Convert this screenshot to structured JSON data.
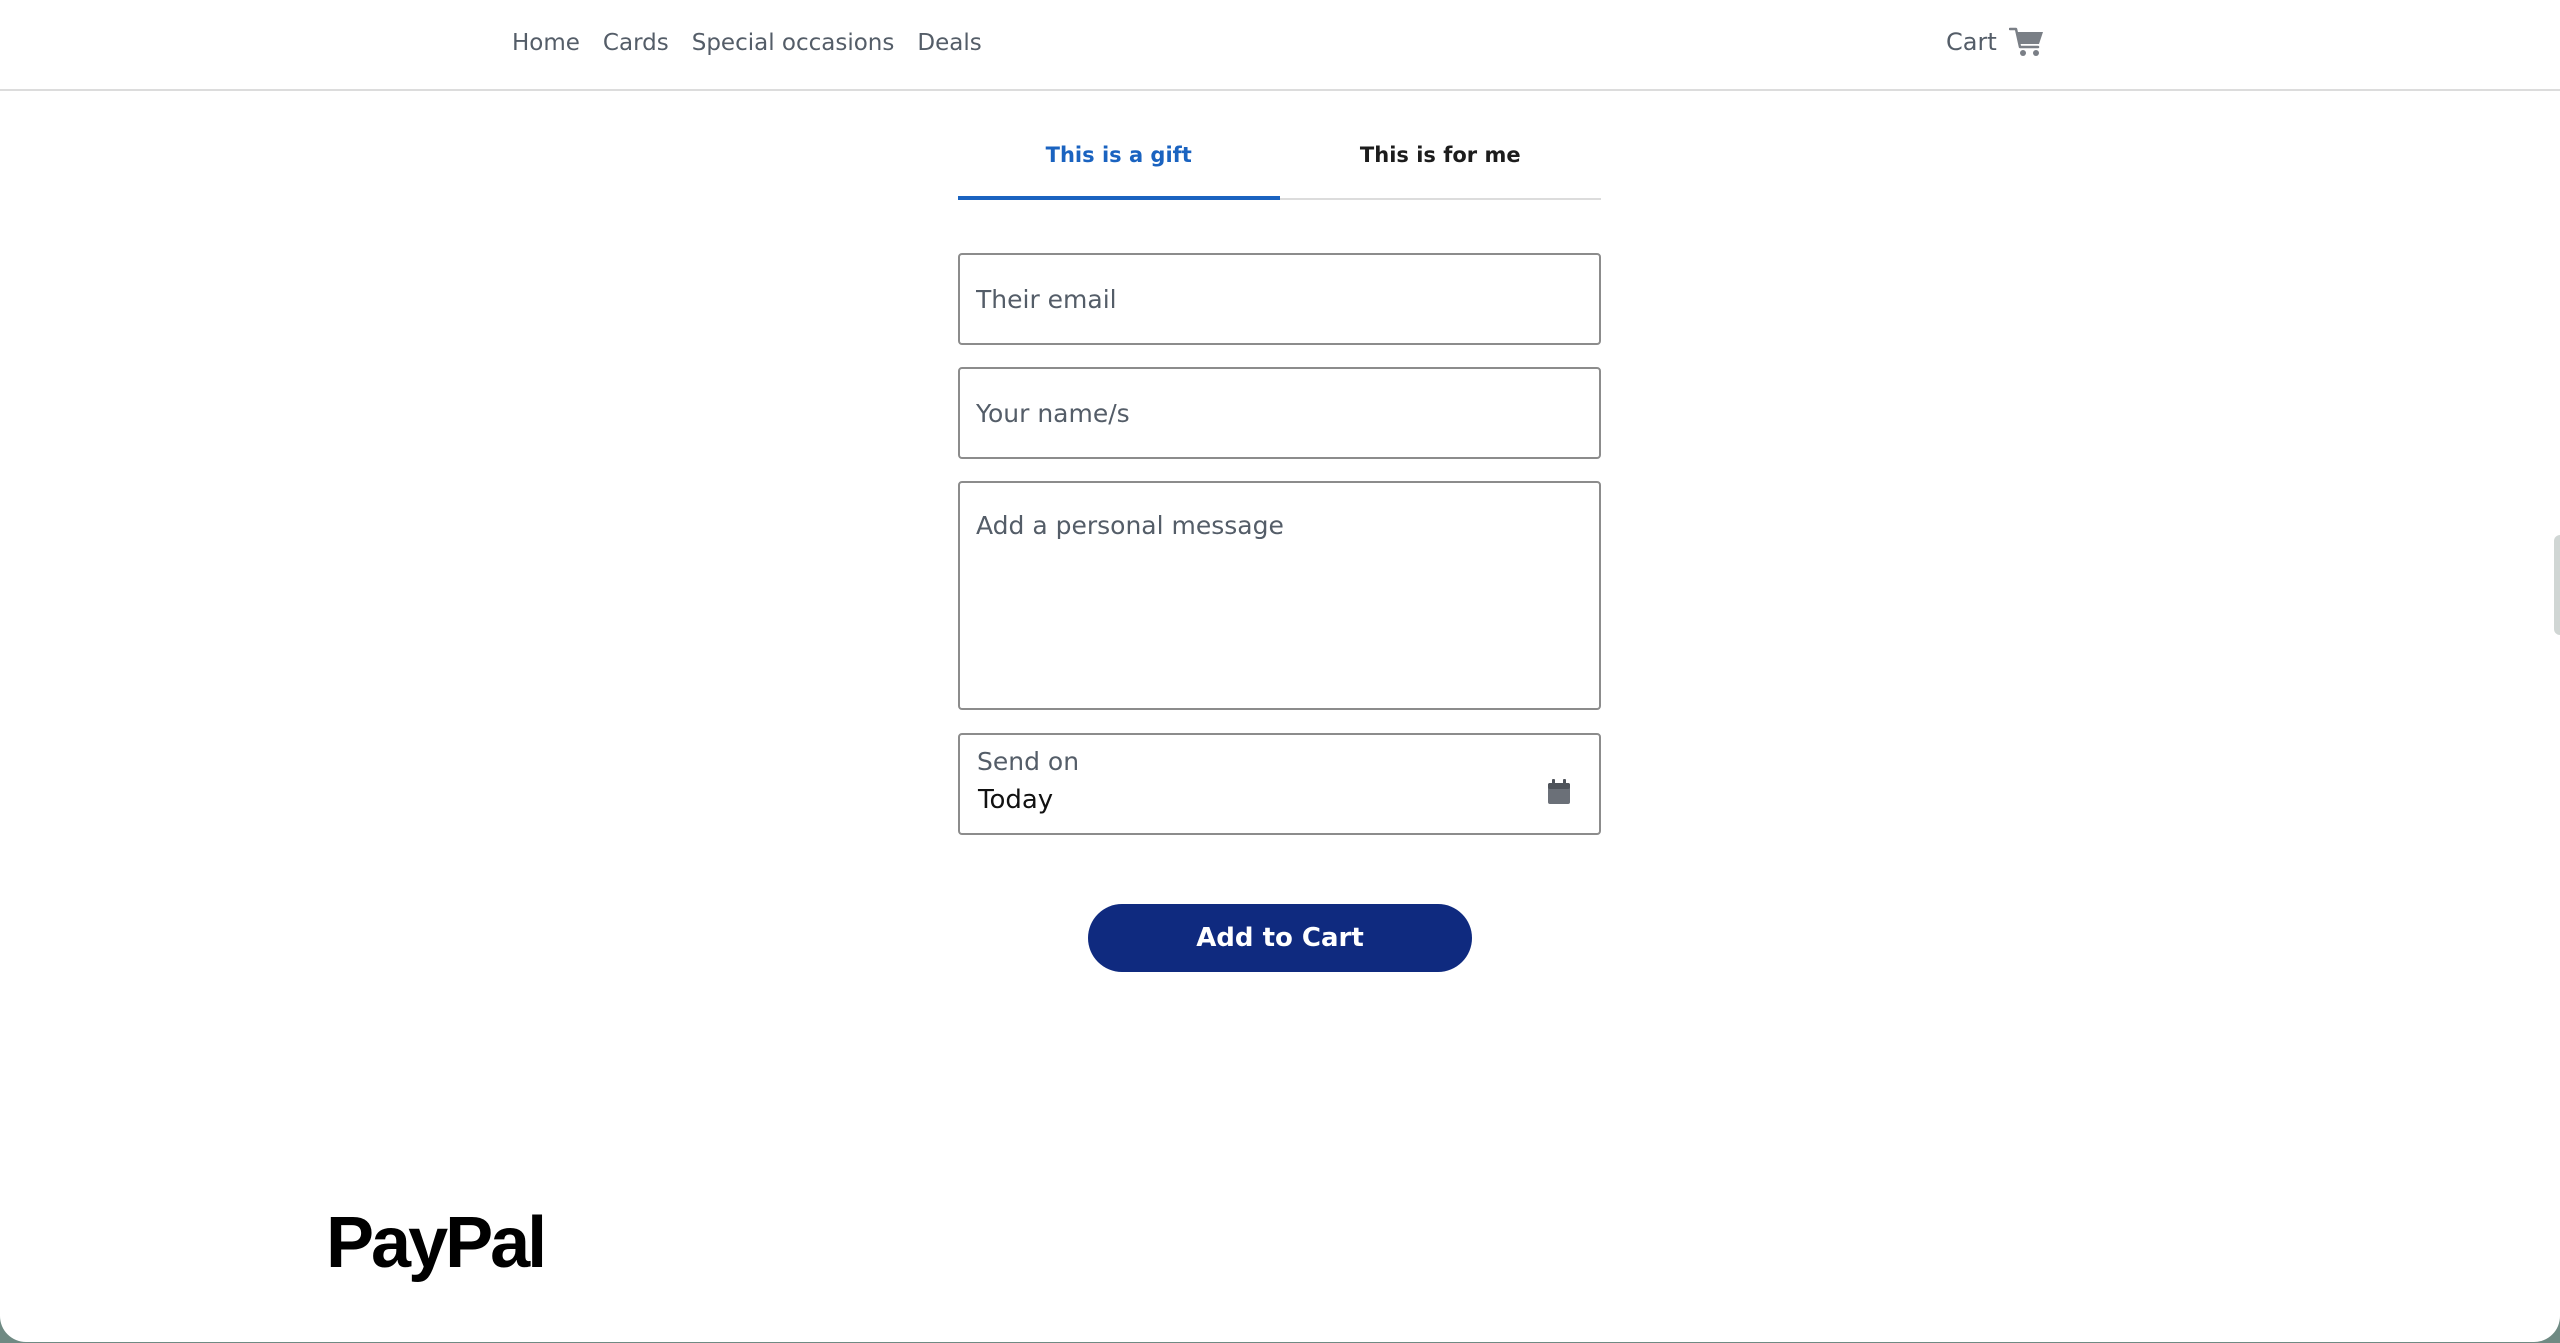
{
  "nav": {
    "links": [
      "Home",
      "Cards",
      "Special occasions",
      "Deals"
    ],
    "cart_label": "Cart"
  },
  "tabs": {
    "gift": "This is a gift",
    "self": "This is for me",
    "active": "gift"
  },
  "form": {
    "email_placeholder": "Their email",
    "name_placeholder": "Your name/s",
    "message_placeholder": "Add a personal message",
    "send_on_label": "Send on",
    "send_on_value": "Today"
  },
  "button": {
    "add_to_cart": "Add to Cart"
  },
  "footer": {
    "logo_text": "PayPal"
  },
  "colors": {
    "accent": "#1a63c0",
    "button": "#0f2a7f"
  }
}
